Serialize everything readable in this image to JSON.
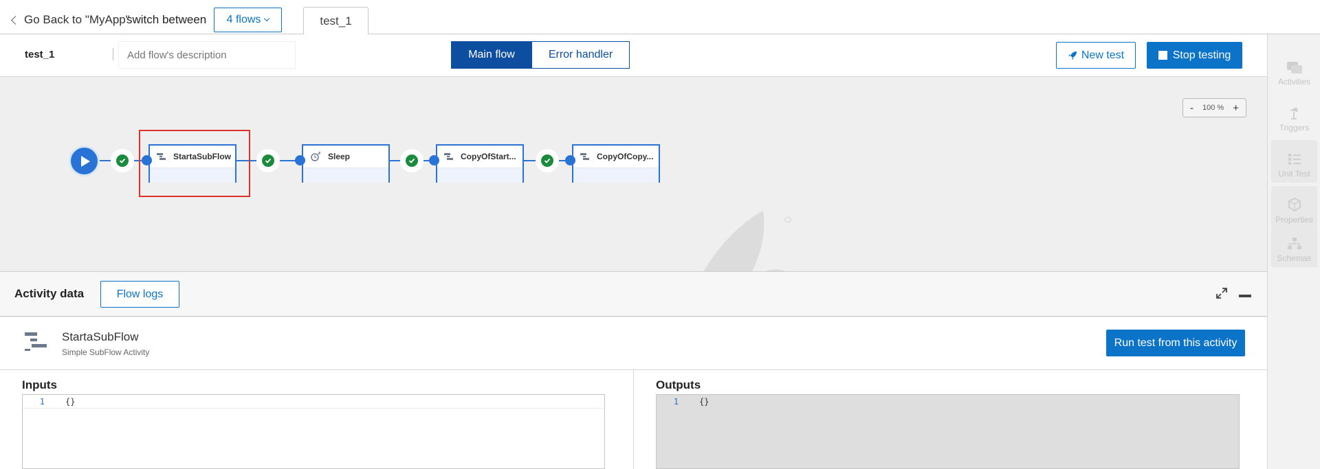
{
  "topbar": {
    "back_label": "Go Back to \"MyApp\"",
    "switch_label": "switch between",
    "flows_dropdown": "4 flows",
    "active_tab": "test_1"
  },
  "flowbar": {
    "flow_name": "test_1",
    "description_placeholder": "Add flow's description",
    "main_flow": "Main flow",
    "error_handler": "Error handler",
    "new_test": "New test",
    "stop_testing": "Stop testing"
  },
  "canvas": {
    "zoom_minus": "-",
    "zoom_level": "100 %",
    "zoom_plus": "+",
    "nodes": [
      {
        "label": "StartaSubFlow",
        "icon": "subflow-icon"
      },
      {
        "label": "Sleep",
        "icon": "sleep-icon"
      },
      {
        "label": "CopyOfStart...",
        "icon": "subflow-icon"
      },
      {
        "label": "CopyOfCopy...",
        "icon": "subflow-icon"
      }
    ],
    "colors": {
      "connector": "#2a73d6",
      "success": "#1a8a3c",
      "selection": "#e0322b"
    }
  },
  "activity_bar": {
    "title": "Activity data",
    "flow_logs": "Flow logs"
  },
  "activity": {
    "name": "StartaSubFlow",
    "type": "Simple SubFlow Activity",
    "run_button": "Run test from this activity"
  },
  "inputs": {
    "label": "Inputs",
    "line_no": "1",
    "code": "{}"
  },
  "outputs": {
    "label": "Outputs",
    "line_no": "1",
    "code": "{}"
  },
  "rail": {
    "activities": "Activities",
    "triggers": "Triggers",
    "unit_test": "Unit Test",
    "properties": "Properties",
    "schemas": "Schemas"
  }
}
